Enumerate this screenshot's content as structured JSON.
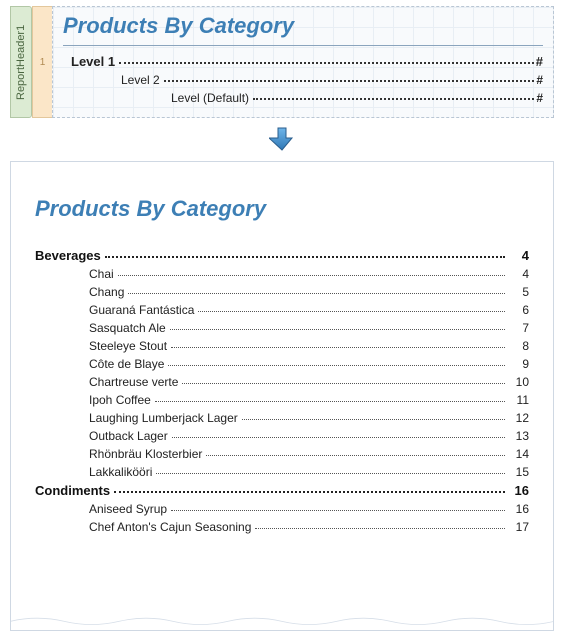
{
  "designer": {
    "sidebar_label": "ReportHeader1",
    "ruler_mark": "1",
    "title": "Products By Category",
    "levels": {
      "l1": {
        "label": "Level 1",
        "page_placeholder": "#"
      },
      "l2": {
        "label": "Level 2",
        "page_placeholder": "#"
      },
      "default": {
        "label": "Level (Default)",
        "page_placeholder": "#"
      }
    }
  },
  "preview": {
    "title": "Products By Category",
    "toc": [
      {
        "label": "Beverages",
        "page": "4",
        "children": [
          {
            "label": "Chai",
            "page": "4"
          },
          {
            "label": "Chang",
            "page": "5"
          },
          {
            "label": "Guaraná Fantástica",
            "page": "6"
          },
          {
            "label": "Sasquatch Ale",
            "page": "7"
          },
          {
            "label": "Steeleye Stout",
            "page": "8"
          },
          {
            "label": "Côte de Blaye",
            "page": "9"
          },
          {
            "label": "Chartreuse verte",
            "page": "10"
          },
          {
            "label": "Ipoh Coffee",
            "page": "11"
          },
          {
            "label": "Laughing Lumberjack Lager",
            "page": "12"
          },
          {
            "label": "Outback Lager",
            "page": "13"
          },
          {
            "label": "Rhönbräu Klosterbier",
            "page": "14"
          },
          {
            "label": "Lakkalikööri",
            "page": "15"
          }
        ]
      },
      {
        "label": "Condiments",
        "page": "16",
        "children": [
          {
            "label": "Aniseed Syrup",
            "page": "16"
          },
          {
            "label": "Chef Anton's Cajun Seasoning",
            "page": "17"
          }
        ]
      }
    ]
  }
}
